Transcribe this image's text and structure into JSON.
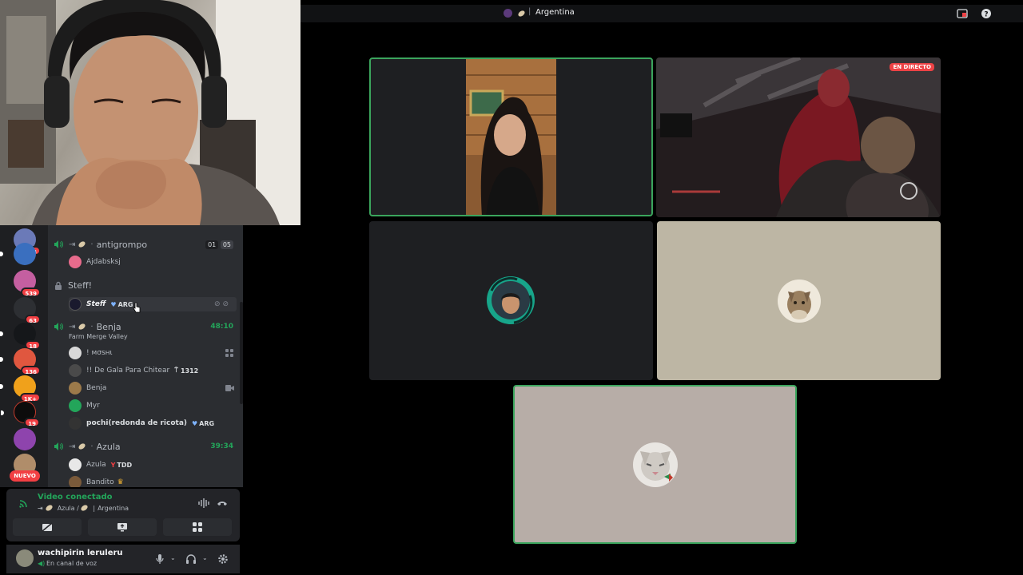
{
  "window": {
    "title": "Argentina"
  },
  "servers": [
    {
      "name": "server-1",
      "badge": "13"
    },
    {
      "name": "server-2",
      "badge": ""
    },
    {
      "name": "server-3",
      "badge": "539"
    },
    {
      "name": "server-4",
      "badge": "63"
    },
    {
      "name": "server-5",
      "badge": "18"
    },
    {
      "name": "server-6",
      "badge": "136"
    },
    {
      "name": "server-7",
      "badge": "1K+"
    },
    {
      "name": "server-8",
      "badge": "19"
    },
    {
      "name": "server-9",
      "badge": ""
    },
    {
      "name": "server-10",
      "badge": ""
    }
  ],
  "nuevo_label": "NUEVO",
  "channels": {
    "antigrompo": {
      "name": "antigrompo",
      "limit_a": "01",
      "limit_b": "05",
      "users": [
        "Ajdabsksj"
      ]
    },
    "steff": {
      "name": "Steff!",
      "user": "Steff",
      "user_tag": "ARG"
    },
    "benja": {
      "name": "Benja",
      "timer": "48:10",
      "activity": "Farm Merge Valley",
      "users": [
        {
          "name": "! мσѕнι",
          "tag": ""
        },
        {
          "name": "!! De Gala Para Chitear",
          "tag": "1312"
        },
        {
          "name": "Benja",
          "tag": ""
        },
        {
          "name": "Myr",
          "tag": ""
        },
        {
          "name": "pochi(redonda de ricota)",
          "tag": "ARG"
        }
      ]
    },
    "azula": {
      "name": "Azula",
      "timer": "39:34",
      "users": [
        {
          "name": "Azula",
          "tag": "TDD"
        },
        {
          "name": "Bandito",
          "tag": ""
        }
      ]
    }
  },
  "voice": {
    "status": "Video conectado",
    "location": "Azula / ",
    "location2": "Argentina"
  },
  "user": {
    "name": "wachipirin leruleru",
    "status": "En canal de voz"
  },
  "stream": {
    "live_label": "EN DIRECTO"
  }
}
